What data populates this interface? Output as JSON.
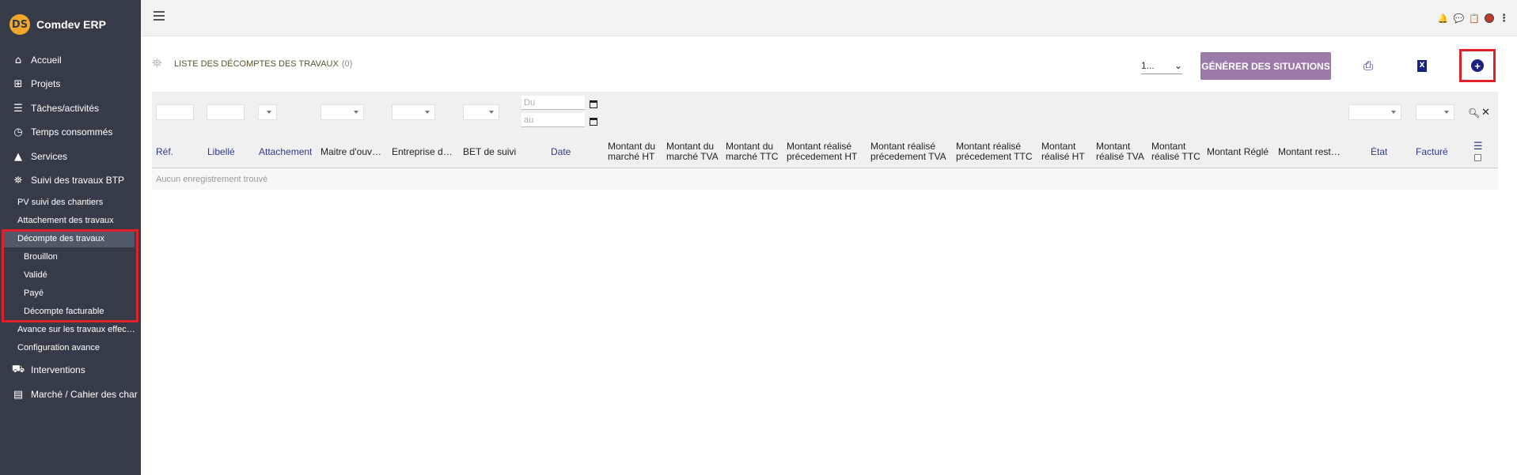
{
  "brand": {
    "name": "Comdev ERP",
    "logo_text": "DS"
  },
  "sidebar": {
    "items": [
      {
        "label": "Accueil",
        "icon": "home-icon",
        "glyph": "⌂"
      },
      {
        "label": "Projets",
        "icon": "sitemap-icon",
        "glyph": "⊞"
      },
      {
        "label": "Tâches/activités",
        "icon": "tasks-icon",
        "glyph": "☰"
      },
      {
        "label": "Temps consommés",
        "icon": "clock-icon",
        "glyph": "◷"
      },
      {
        "label": "Services",
        "icon": "bell-icon",
        "glyph": "▲"
      },
      {
        "label": "Suivi des travaux BTP",
        "icon": "binoculars-icon",
        "glyph": "⛯"
      }
    ],
    "sub_items": [
      {
        "label": "PV suivi des chantiers"
      },
      {
        "label": "Attachement des travaux"
      },
      {
        "label": "Décompte des travaux"
      }
    ],
    "sub2_items": [
      {
        "label": "Brouillon"
      },
      {
        "label": "Validé"
      },
      {
        "label": "Payé"
      },
      {
        "label": "Décompte facturable"
      }
    ],
    "more_sub_items": [
      {
        "label": "Avance sur les travaux effectués"
      },
      {
        "label": "Configuration avance"
      }
    ],
    "bottom_items": [
      {
        "label": "Interventions",
        "icon": "truck-icon",
        "glyph": "⛟"
      },
      {
        "label": "Marché / Cahier des charges",
        "icon": "book-icon",
        "glyph": "▤"
      }
    ]
  },
  "header": {
    "title": "Liste des décomptes des travaux",
    "count": "(0)",
    "per_page": "1...",
    "generate_label": "Générer des situations"
  },
  "filters": {
    "date_from_placeholder": "Du",
    "date_to_placeholder": "au"
  },
  "table": {
    "columns": [
      {
        "label": "Réf."
      },
      {
        "label": "Libellé"
      },
      {
        "label": "Attachement"
      },
      {
        "label": "Maitre d'ouvrage"
      },
      {
        "label": "Entreprise de travaux"
      },
      {
        "label": "BET de suivi"
      },
      {
        "label": "Date"
      },
      {
        "label_1": "Montant du",
        "label_2": "marché HT"
      },
      {
        "label_1": "Montant du",
        "label_2": "marché TVA"
      },
      {
        "label_1": "Montant du",
        "label_2": "marché TTC"
      },
      {
        "label_1": "Montant réalisé",
        "label_2": "précedement HT"
      },
      {
        "label_1": "Montant réalisé",
        "label_2": "précedement TVA"
      },
      {
        "label_1": "Montant réalisé",
        "label_2": "précedement TTC"
      },
      {
        "label_1": "Montant",
        "label_2": "réalisé HT"
      },
      {
        "label_1": "Montant",
        "label_2": "réalisé TVA"
      },
      {
        "label_1": "Montant",
        "label_2": "réalisé TTC"
      },
      {
        "label": "Montant Réglé"
      },
      {
        "label": "Montant restant"
      },
      {
        "label": "État"
      },
      {
        "label": "Facturé"
      }
    ],
    "empty_text": "Aucun enregistrement trouvé"
  },
  "colors": {
    "sidebar_bg": "#363c47",
    "accent_button": "#9b79a8",
    "highlight_red": "#e0202a",
    "link_blue": "#2f3a8f",
    "icon_navy": "#1a237e"
  }
}
